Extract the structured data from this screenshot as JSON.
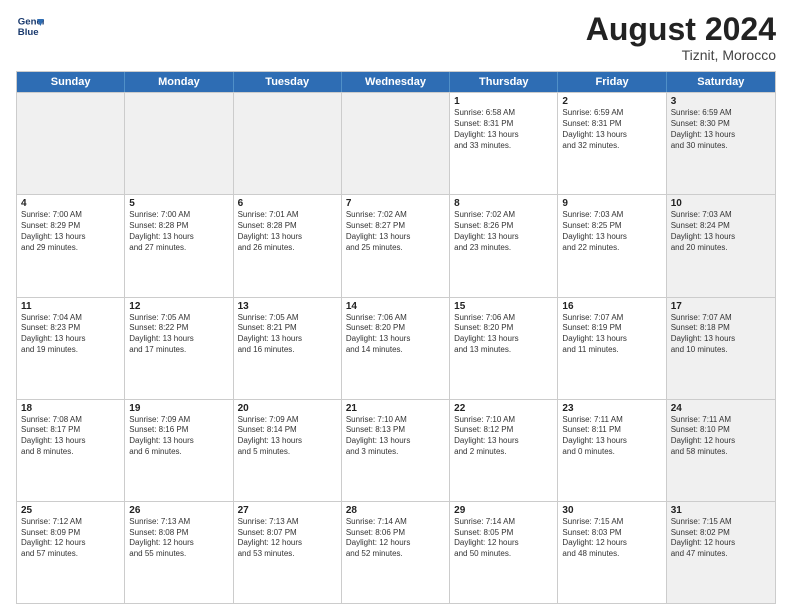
{
  "header": {
    "logo_line1": "General",
    "logo_line2": "Blue",
    "month_year": "August 2024",
    "location": "Tiznit, Morocco"
  },
  "weekdays": [
    "Sunday",
    "Monday",
    "Tuesday",
    "Wednesday",
    "Thursday",
    "Friday",
    "Saturday"
  ],
  "rows": [
    [
      {
        "day": "",
        "info": "",
        "shaded": true
      },
      {
        "day": "",
        "info": "",
        "shaded": true
      },
      {
        "day": "",
        "info": "",
        "shaded": true
      },
      {
        "day": "",
        "info": "",
        "shaded": true
      },
      {
        "day": "1",
        "info": "Sunrise: 6:58 AM\nSunset: 8:31 PM\nDaylight: 13 hours\nand 33 minutes.",
        "shaded": false
      },
      {
        "day": "2",
        "info": "Sunrise: 6:59 AM\nSunset: 8:31 PM\nDaylight: 13 hours\nand 32 minutes.",
        "shaded": false
      },
      {
        "day": "3",
        "info": "Sunrise: 6:59 AM\nSunset: 8:30 PM\nDaylight: 13 hours\nand 30 minutes.",
        "shaded": true
      }
    ],
    [
      {
        "day": "4",
        "info": "Sunrise: 7:00 AM\nSunset: 8:29 PM\nDaylight: 13 hours\nand 29 minutes.",
        "shaded": false
      },
      {
        "day": "5",
        "info": "Sunrise: 7:00 AM\nSunset: 8:28 PM\nDaylight: 13 hours\nand 27 minutes.",
        "shaded": false
      },
      {
        "day": "6",
        "info": "Sunrise: 7:01 AM\nSunset: 8:28 PM\nDaylight: 13 hours\nand 26 minutes.",
        "shaded": false
      },
      {
        "day": "7",
        "info": "Sunrise: 7:02 AM\nSunset: 8:27 PM\nDaylight: 13 hours\nand 25 minutes.",
        "shaded": false
      },
      {
        "day": "8",
        "info": "Sunrise: 7:02 AM\nSunset: 8:26 PM\nDaylight: 13 hours\nand 23 minutes.",
        "shaded": false
      },
      {
        "day": "9",
        "info": "Sunrise: 7:03 AM\nSunset: 8:25 PM\nDaylight: 13 hours\nand 22 minutes.",
        "shaded": false
      },
      {
        "day": "10",
        "info": "Sunrise: 7:03 AM\nSunset: 8:24 PM\nDaylight: 13 hours\nand 20 minutes.",
        "shaded": true
      }
    ],
    [
      {
        "day": "11",
        "info": "Sunrise: 7:04 AM\nSunset: 8:23 PM\nDaylight: 13 hours\nand 19 minutes.",
        "shaded": false
      },
      {
        "day": "12",
        "info": "Sunrise: 7:05 AM\nSunset: 8:22 PM\nDaylight: 13 hours\nand 17 minutes.",
        "shaded": false
      },
      {
        "day": "13",
        "info": "Sunrise: 7:05 AM\nSunset: 8:21 PM\nDaylight: 13 hours\nand 16 minutes.",
        "shaded": false
      },
      {
        "day": "14",
        "info": "Sunrise: 7:06 AM\nSunset: 8:20 PM\nDaylight: 13 hours\nand 14 minutes.",
        "shaded": false
      },
      {
        "day": "15",
        "info": "Sunrise: 7:06 AM\nSunset: 8:20 PM\nDaylight: 13 hours\nand 13 minutes.",
        "shaded": false
      },
      {
        "day": "16",
        "info": "Sunrise: 7:07 AM\nSunset: 8:19 PM\nDaylight: 13 hours\nand 11 minutes.",
        "shaded": false
      },
      {
        "day": "17",
        "info": "Sunrise: 7:07 AM\nSunset: 8:18 PM\nDaylight: 13 hours\nand 10 minutes.",
        "shaded": true
      }
    ],
    [
      {
        "day": "18",
        "info": "Sunrise: 7:08 AM\nSunset: 8:17 PM\nDaylight: 13 hours\nand 8 minutes.",
        "shaded": false
      },
      {
        "day": "19",
        "info": "Sunrise: 7:09 AM\nSunset: 8:16 PM\nDaylight: 13 hours\nand 6 minutes.",
        "shaded": false
      },
      {
        "day": "20",
        "info": "Sunrise: 7:09 AM\nSunset: 8:14 PM\nDaylight: 13 hours\nand 5 minutes.",
        "shaded": false
      },
      {
        "day": "21",
        "info": "Sunrise: 7:10 AM\nSunset: 8:13 PM\nDaylight: 13 hours\nand 3 minutes.",
        "shaded": false
      },
      {
        "day": "22",
        "info": "Sunrise: 7:10 AM\nSunset: 8:12 PM\nDaylight: 13 hours\nand 2 minutes.",
        "shaded": false
      },
      {
        "day": "23",
        "info": "Sunrise: 7:11 AM\nSunset: 8:11 PM\nDaylight: 13 hours\nand 0 minutes.",
        "shaded": false
      },
      {
        "day": "24",
        "info": "Sunrise: 7:11 AM\nSunset: 8:10 PM\nDaylight: 12 hours\nand 58 minutes.",
        "shaded": true
      }
    ],
    [
      {
        "day": "25",
        "info": "Sunrise: 7:12 AM\nSunset: 8:09 PM\nDaylight: 12 hours\nand 57 minutes.",
        "shaded": false
      },
      {
        "day": "26",
        "info": "Sunrise: 7:13 AM\nSunset: 8:08 PM\nDaylight: 12 hours\nand 55 minutes.",
        "shaded": false
      },
      {
        "day": "27",
        "info": "Sunrise: 7:13 AM\nSunset: 8:07 PM\nDaylight: 12 hours\nand 53 minutes.",
        "shaded": false
      },
      {
        "day": "28",
        "info": "Sunrise: 7:14 AM\nSunset: 8:06 PM\nDaylight: 12 hours\nand 52 minutes.",
        "shaded": false
      },
      {
        "day": "29",
        "info": "Sunrise: 7:14 AM\nSunset: 8:05 PM\nDaylight: 12 hours\nand 50 minutes.",
        "shaded": false
      },
      {
        "day": "30",
        "info": "Sunrise: 7:15 AM\nSunset: 8:03 PM\nDaylight: 12 hours\nand 48 minutes.",
        "shaded": false
      },
      {
        "day": "31",
        "info": "Sunrise: 7:15 AM\nSunset: 8:02 PM\nDaylight: 12 hours\nand 47 minutes.",
        "shaded": true
      }
    ]
  ]
}
